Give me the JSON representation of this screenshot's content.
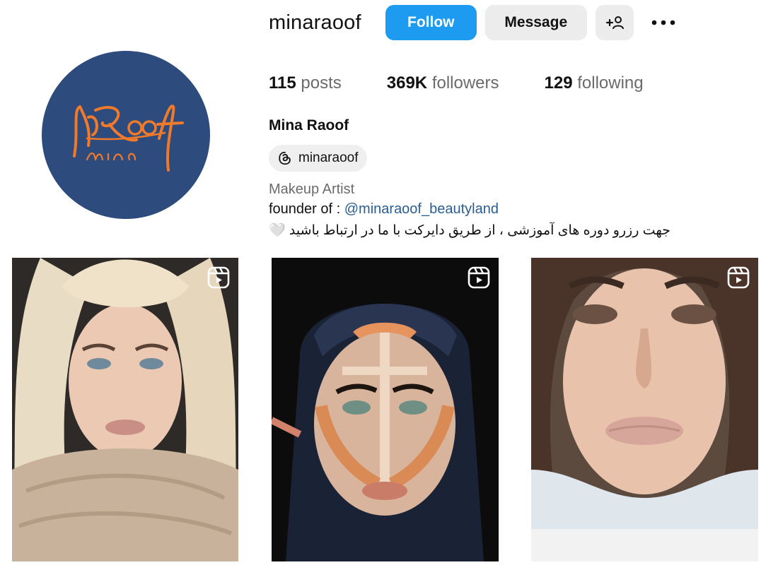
{
  "profile": {
    "username": "minaraoof",
    "full_name": "Mina Raoof",
    "avatar_logo_text": "Raoof",
    "avatar_logo_sub": "Mina",
    "avatar_bg": "#2e4b7e",
    "avatar_logo_color": "#f07a2a"
  },
  "actions": {
    "follow_label": "Follow",
    "message_label": "Message",
    "add_user_icon": "add-user-icon",
    "more_icon": "more-horizontal-icon",
    "follow_color": "#1d9bf0"
  },
  "stats": {
    "posts_count": "115",
    "posts_label": "posts",
    "followers_count": "369K",
    "followers_label": "followers",
    "following_count": "129",
    "following_label": "following"
  },
  "threads_badge": {
    "icon": "threads-icon",
    "handle": "minaraoof"
  },
  "bio": {
    "line1": "Makeup Artist",
    "line2_prefix": "founder of : ",
    "line2_mention": "@minaraoof_beautyland",
    "line3": "جهت رزرو دوره های آموزشی ، از طریق دایرکت با ما در ارتباط باشید 🤍"
  },
  "grid": {
    "items": [
      {
        "type": "reel",
        "icon": "reels-icon"
      },
      {
        "type": "reel",
        "icon": "reels-icon"
      },
      {
        "type": "reel",
        "icon": "reels-icon"
      }
    ]
  }
}
